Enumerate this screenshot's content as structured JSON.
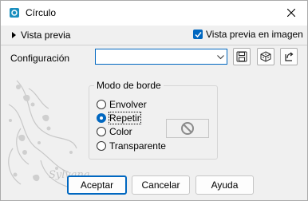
{
  "window": {
    "title": "Círculo",
    "close_icon": "close-icon"
  },
  "toolbar": {
    "preview_toggle_label": "Vista previa",
    "live_preview_label": "Vista previa en imagen",
    "live_preview_checked": true
  },
  "preset": {
    "label": "Configuración",
    "value": "",
    "buttons": [
      "save-preset-icon",
      "load-preset-icon",
      "reset-icon"
    ]
  },
  "border_mode": {
    "legend": "Modo de borde",
    "options": [
      {
        "label": "Envolver",
        "selected": false
      },
      {
        "label": "Repetir",
        "selected": true
      },
      {
        "label": "Color",
        "selected": false
      },
      {
        "label": "Transparente",
        "selected": false
      }
    ],
    "color_swatch_icon": "no-color-icon"
  },
  "buttons": {
    "ok": "Aceptar",
    "cancel": "Cancelar",
    "help": "Ayuda"
  },
  "watermark": {
    "text": "Sylvana"
  },
  "colors": {
    "accent": "#0067c0",
    "background": "#f0f0f0",
    "titlebar": "#ffffff"
  }
}
